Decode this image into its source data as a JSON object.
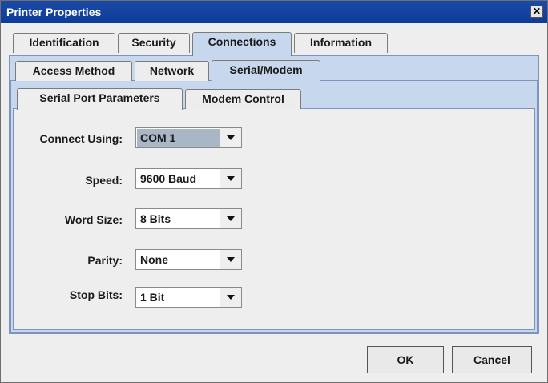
{
  "window": {
    "title": "Printer Properties",
    "close_glyph": "✕"
  },
  "main_tabs": [
    {
      "label": "Identification"
    },
    {
      "label": "Security"
    },
    {
      "label": "Connections"
    },
    {
      "label": "Information"
    }
  ],
  "sub_tabs": [
    {
      "label": "Access Method"
    },
    {
      "label": "Network"
    },
    {
      "label": "Serial/Modem"
    }
  ],
  "inner_tabs": [
    {
      "label": "Serial Port Parameters"
    },
    {
      "label": "Modem Control"
    }
  ],
  "fields": [
    {
      "label": "Connect Using:",
      "value": "COM 1"
    },
    {
      "label": "Speed:",
      "value": "9600 Baud"
    },
    {
      "label": "Word Size:",
      "value": "8 Bits"
    },
    {
      "label": "Parity:",
      "value": "None"
    },
    {
      "label": "Stop Bits:",
      "value": "1 Bit"
    }
  ],
  "buttons": {
    "ok": "OK",
    "cancel": "Cancel"
  },
  "colors": {
    "titlebar": "#0d3d99",
    "active_tab": "#c7d8ee",
    "focused_combo": "#a9b6c6"
  }
}
